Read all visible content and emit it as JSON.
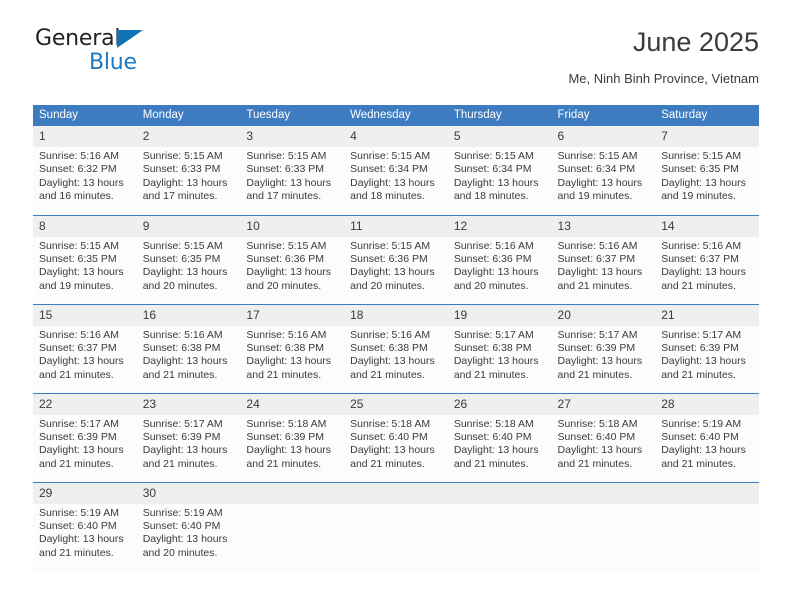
{
  "logo": {
    "word_one": "General",
    "word_two": "Blue",
    "triangle_color": "#1272b8",
    "blue_color": "#1b7ac4"
  },
  "header": {
    "title": "June 2025",
    "subtitle": "Me, Ninh Binh Province, Vietnam"
  },
  "theme": {
    "header_blue": "#3d7cc0",
    "daynum_band": "#efefef",
    "cell_background": "#fcfcfd",
    "text": "#3b3b3b"
  },
  "weekdays": [
    "Sunday",
    "Monday",
    "Tuesday",
    "Wednesday",
    "Thursday",
    "Friday",
    "Saturday"
  ],
  "weeks": [
    {
      "days": [
        {
          "date": "1",
          "sunrise": "Sunrise: 5:16 AM",
          "sunset": "Sunset: 6:32 PM",
          "daylight_line1": "Daylight: 13 hours",
          "daylight_line2": "and 16 minutes."
        },
        {
          "date": "2",
          "sunrise": "Sunrise: 5:15 AM",
          "sunset": "Sunset: 6:33 PM",
          "daylight_line1": "Daylight: 13 hours",
          "daylight_line2": "and 17 minutes."
        },
        {
          "date": "3",
          "sunrise": "Sunrise: 5:15 AM",
          "sunset": "Sunset: 6:33 PM",
          "daylight_line1": "Daylight: 13 hours",
          "daylight_line2": "and 17 minutes."
        },
        {
          "date": "4",
          "sunrise": "Sunrise: 5:15 AM",
          "sunset": "Sunset: 6:34 PM",
          "daylight_line1": "Daylight: 13 hours",
          "daylight_line2": "and 18 minutes."
        },
        {
          "date": "5",
          "sunrise": "Sunrise: 5:15 AM",
          "sunset": "Sunset: 6:34 PM",
          "daylight_line1": "Daylight: 13 hours",
          "daylight_line2": "and 18 minutes."
        },
        {
          "date": "6",
          "sunrise": "Sunrise: 5:15 AM",
          "sunset": "Sunset: 6:34 PM",
          "daylight_line1": "Daylight: 13 hours",
          "daylight_line2": "and 19 minutes."
        },
        {
          "date": "7",
          "sunrise": "Sunrise: 5:15 AM",
          "sunset": "Sunset: 6:35 PM",
          "daylight_line1": "Daylight: 13 hours",
          "daylight_line2": "and 19 minutes."
        }
      ]
    },
    {
      "days": [
        {
          "date": "8",
          "sunrise": "Sunrise: 5:15 AM",
          "sunset": "Sunset: 6:35 PM",
          "daylight_line1": "Daylight: 13 hours",
          "daylight_line2": "and 19 minutes."
        },
        {
          "date": "9",
          "sunrise": "Sunrise: 5:15 AM",
          "sunset": "Sunset: 6:35 PM",
          "daylight_line1": "Daylight: 13 hours",
          "daylight_line2": "and 20 minutes."
        },
        {
          "date": "10",
          "sunrise": "Sunrise: 5:15 AM",
          "sunset": "Sunset: 6:36 PM",
          "daylight_line1": "Daylight: 13 hours",
          "daylight_line2": "and 20 minutes."
        },
        {
          "date": "11",
          "sunrise": "Sunrise: 5:15 AM",
          "sunset": "Sunset: 6:36 PM",
          "daylight_line1": "Daylight: 13 hours",
          "daylight_line2": "and 20 minutes."
        },
        {
          "date": "12",
          "sunrise": "Sunrise: 5:16 AM",
          "sunset": "Sunset: 6:36 PM",
          "daylight_line1": "Daylight: 13 hours",
          "daylight_line2": "and 20 minutes."
        },
        {
          "date": "13",
          "sunrise": "Sunrise: 5:16 AM",
          "sunset": "Sunset: 6:37 PM",
          "daylight_line1": "Daylight: 13 hours",
          "daylight_line2": "and 21 minutes."
        },
        {
          "date": "14",
          "sunrise": "Sunrise: 5:16 AM",
          "sunset": "Sunset: 6:37 PM",
          "daylight_line1": "Daylight: 13 hours",
          "daylight_line2": "and 21 minutes."
        }
      ]
    },
    {
      "days": [
        {
          "date": "15",
          "sunrise": "Sunrise: 5:16 AM",
          "sunset": "Sunset: 6:37 PM",
          "daylight_line1": "Daylight: 13 hours",
          "daylight_line2": "and 21 minutes."
        },
        {
          "date": "16",
          "sunrise": "Sunrise: 5:16 AM",
          "sunset": "Sunset: 6:38 PM",
          "daylight_line1": "Daylight: 13 hours",
          "daylight_line2": "and 21 minutes."
        },
        {
          "date": "17",
          "sunrise": "Sunrise: 5:16 AM",
          "sunset": "Sunset: 6:38 PM",
          "daylight_line1": "Daylight: 13 hours",
          "daylight_line2": "and 21 minutes."
        },
        {
          "date": "18",
          "sunrise": "Sunrise: 5:16 AM",
          "sunset": "Sunset: 6:38 PM",
          "daylight_line1": "Daylight: 13 hours",
          "daylight_line2": "and 21 minutes."
        },
        {
          "date": "19",
          "sunrise": "Sunrise: 5:17 AM",
          "sunset": "Sunset: 6:38 PM",
          "daylight_line1": "Daylight: 13 hours",
          "daylight_line2": "and 21 minutes."
        },
        {
          "date": "20",
          "sunrise": "Sunrise: 5:17 AM",
          "sunset": "Sunset: 6:39 PM",
          "daylight_line1": "Daylight: 13 hours",
          "daylight_line2": "and 21 minutes."
        },
        {
          "date": "21",
          "sunrise": "Sunrise: 5:17 AM",
          "sunset": "Sunset: 6:39 PM",
          "daylight_line1": "Daylight: 13 hours",
          "daylight_line2": "and 21 minutes."
        }
      ]
    },
    {
      "days": [
        {
          "date": "22",
          "sunrise": "Sunrise: 5:17 AM",
          "sunset": "Sunset: 6:39 PM",
          "daylight_line1": "Daylight: 13 hours",
          "daylight_line2": "and 21 minutes."
        },
        {
          "date": "23",
          "sunrise": "Sunrise: 5:17 AM",
          "sunset": "Sunset: 6:39 PM",
          "daylight_line1": "Daylight: 13 hours",
          "daylight_line2": "and 21 minutes."
        },
        {
          "date": "24",
          "sunrise": "Sunrise: 5:18 AM",
          "sunset": "Sunset: 6:39 PM",
          "daylight_line1": "Daylight: 13 hours",
          "daylight_line2": "and 21 minutes."
        },
        {
          "date": "25",
          "sunrise": "Sunrise: 5:18 AM",
          "sunset": "Sunset: 6:40 PM",
          "daylight_line1": "Daylight: 13 hours",
          "daylight_line2": "and 21 minutes."
        },
        {
          "date": "26",
          "sunrise": "Sunrise: 5:18 AM",
          "sunset": "Sunset: 6:40 PM",
          "daylight_line1": "Daylight: 13 hours",
          "daylight_line2": "and 21 minutes."
        },
        {
          "date": "27",
          "sunrise": "Sunrise: 5:18 AM",
          "sunset": "Sunset: 6:40 PM",
          "daylight_line1": "Daylight: 13 hours",
          "daylight_line2": "and 21 minutes."
        },
        {
          "date": "28",
          "sunrise": "Sunrise: 5:19 AM",
          "sunset": "Sunset: 6:40 PM",
          "daylight_line1": "Daylight: 13 hours",
          "daylight_line2": "and 21 minutes."
        }
      ]
    },
    {
      "days": [
        {
          "date": "29",
          "sunrise": "Sunrise: 5:19 AM",
          "sunset": "Sunset: 6:40 PM",
          "daylight_line1": "Daylight: 13 hours",
          "daylight_line2": "and 21 minutes."
        },
        {
          "date": "30",
          "sunrise": "Sunrise: 5:19 AM",
          "sunset": "Sunset: 6:40 PM",
          "daylight_line1": "Daylight: 13 hours",
          "daylight_line2": "and 20 minutes."
        },
        {
          "date": "",
          "sunrise": "",
          "sunset": "",
          "daylight_line1": "",
          "daylight_line2": ""
        },
        {
          "date": "",
          "sunrise": "",
          "sunset": "",
          "daylight_line1": "",
          "daylight_line2": ""
        },
        {
          "date": "",
          "sunrise": "",
          "sunset": "",
          "daylight_line1": "",
          "daylight_line2": ""
        },
        {
          "date": "",
          "sunrise": "",
          "sunset": "",
          "daylight_line1": "",
          "daylight_line2": ""
        },
        {
          "date": "",
          "sunrise": "",
          "sunset": "",
          "daylight_line1": "",
          "daylight_line2": ""
        }
      ]
    }
  ]
}
